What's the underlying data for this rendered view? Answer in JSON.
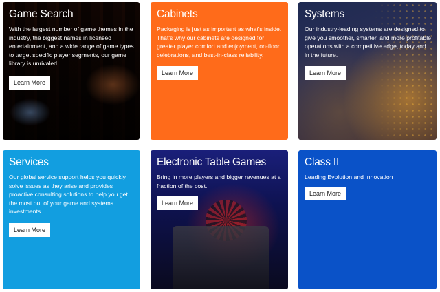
{
  "tiles": [
    {
      "title": "Game Search",
      "description": "With the largest number of game themes in the industry, the biggest names in licensed entertainment, and a wide range of game types to target specific player segments, our game library is unrivaled.",
      "button": "Learn More"
    },
    {
      "title": "Cabinets",
      "description": "Packaging is just as important as what's inside. That's why our cabinets are designed for greater player comfort and enjoyment, on-floor celebrations, and best-in-class reliability.",
      "button": "Learn More"
    },
    {
      "title": "Systems",
      "description": "Our industry-leading systems are designed to give you smoother, smarter, and more profitable operations with a competitive edge, today and in the future.",
      "button": "Learn More"
    },
    {
      "title": "Services",
      "description": "Our global service support helps you quickly solve issues as they arise and provides proactive consulting solutions to help you get the most out of your game and systems investments.",
      "button": "Learn More"
    },
    {
      "title": "Electronic Table Games",
      "description": "Bring in more players and bigger revenues at a fraction of the cost.",
      "button": "Learn More"
    },
    {
      "title": "Class II",
      "description": "Leading Evolution and Innovation",
      "button": "Learn More"
    }
  ],
  "colors": {
    "cabinets": "#ff6b1a",
    "services": "#129ee0",
    "class_ii": "#0a52c8"
  }
}
